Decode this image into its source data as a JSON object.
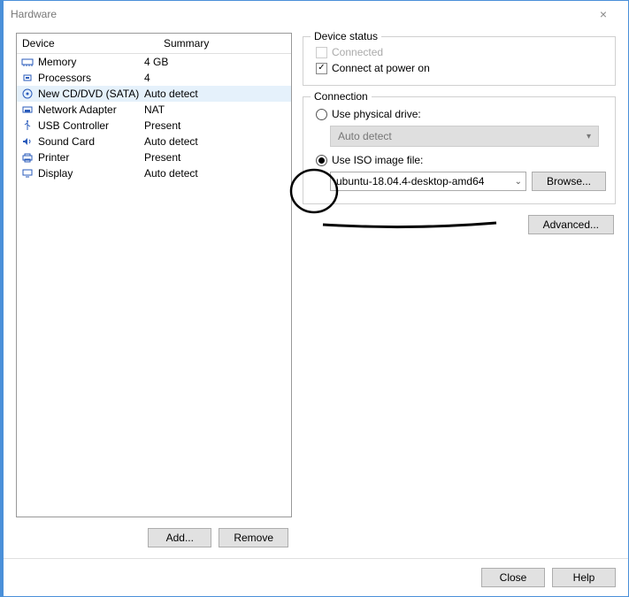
{
  "window": {
    "title": "Hardware"
  },
  "list": {
    "header": {
      "device": "Device",
      "summary": "Summary"
    },
    "rows": [
      {
        "icon": "memory-icon",
        "device": "Memory",
        "summary": "4 GB",
        "selected": false
      },
      {
        "icon": "cpu-icon",
        "device": "Processors",
        "summary": "4",
        "selected": false
      },
      {
        "icon": "cd-icon",
        "device": "New CD/DVD (SATA)",
        "summary": "Auto detect",
        "selected": true
      },
      {
        "icon": "nic-icon",
        "device": "Network Adapter",
        "summary": "NAT",
        "selected": false
      },
      {
        "icon": "usb-icon",
        "device": "USB Controller",
        "summary": "Present",
        "selected": false
      },
      {
        "icon": "sound-icon",
        "device": "Sound Card",
        "summary": "Auto detect",
        "selected": false
      },
      {
        "icon": "printer-icon",
        "device": "Printer",
        "summary": "Present",
        "selected": false
      },
      {
        "icon": "display-icon",
        "device": "Display",
        "summary": "Auto detect",
        "selected": false
      }
    ]
  },
  "buttons": {
    "add": "Add...",
    "remove": "Remove",
    "browse": "Browse...",
    "advanced": "Advanced...",
    "close": "Close",
    "help": "Help"
  },
  "status": {
    "group": "Device status",
    "connected": "Connected",
    "connect_power": "Connect at power on"
  },
  "connection": {
    "group": "Connection",
    "physical": "Use physical drive:",
    "auto": "Auto detect",
    "iso": "Use ISO image file:",
    "iso_value": "ubuntu-18.04.4-desktop-amd64"
  }
}
